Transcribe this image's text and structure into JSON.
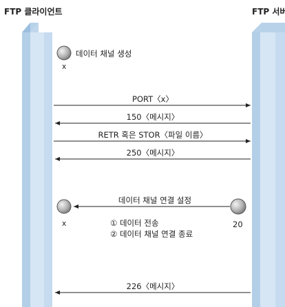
{
  "header": {
    "client_title": "FTP 클라이언트",
    "server_title": "FTP 서버"
  },
  "steps": {
    "create_channel": "데이터 채널 생성",
    "create_channel_port": "x",
    "port": "PORT〈x〉",
    "msg1": "150〈메시지〉",
    "retr": "RETR 혹은 STOR〈파일 이름〉",
    "msg2": "250〈메시지〉",
    "connect": "데이터 채널 연결 설정",
    "client_port": "x",
    "server_port": "20",
    "transfer": "① 데이터 전송",
    "close": "② 데이터 채널 연결 종료",
    "msg3": "226〈메시지〉"
  },
  "colors": {
    "column_fill": "#d6e6f5",
    "column_edge": "#9cbfe0",
    "arrow": "#222222",
    "node": "#9a9a9a"
  }
}
